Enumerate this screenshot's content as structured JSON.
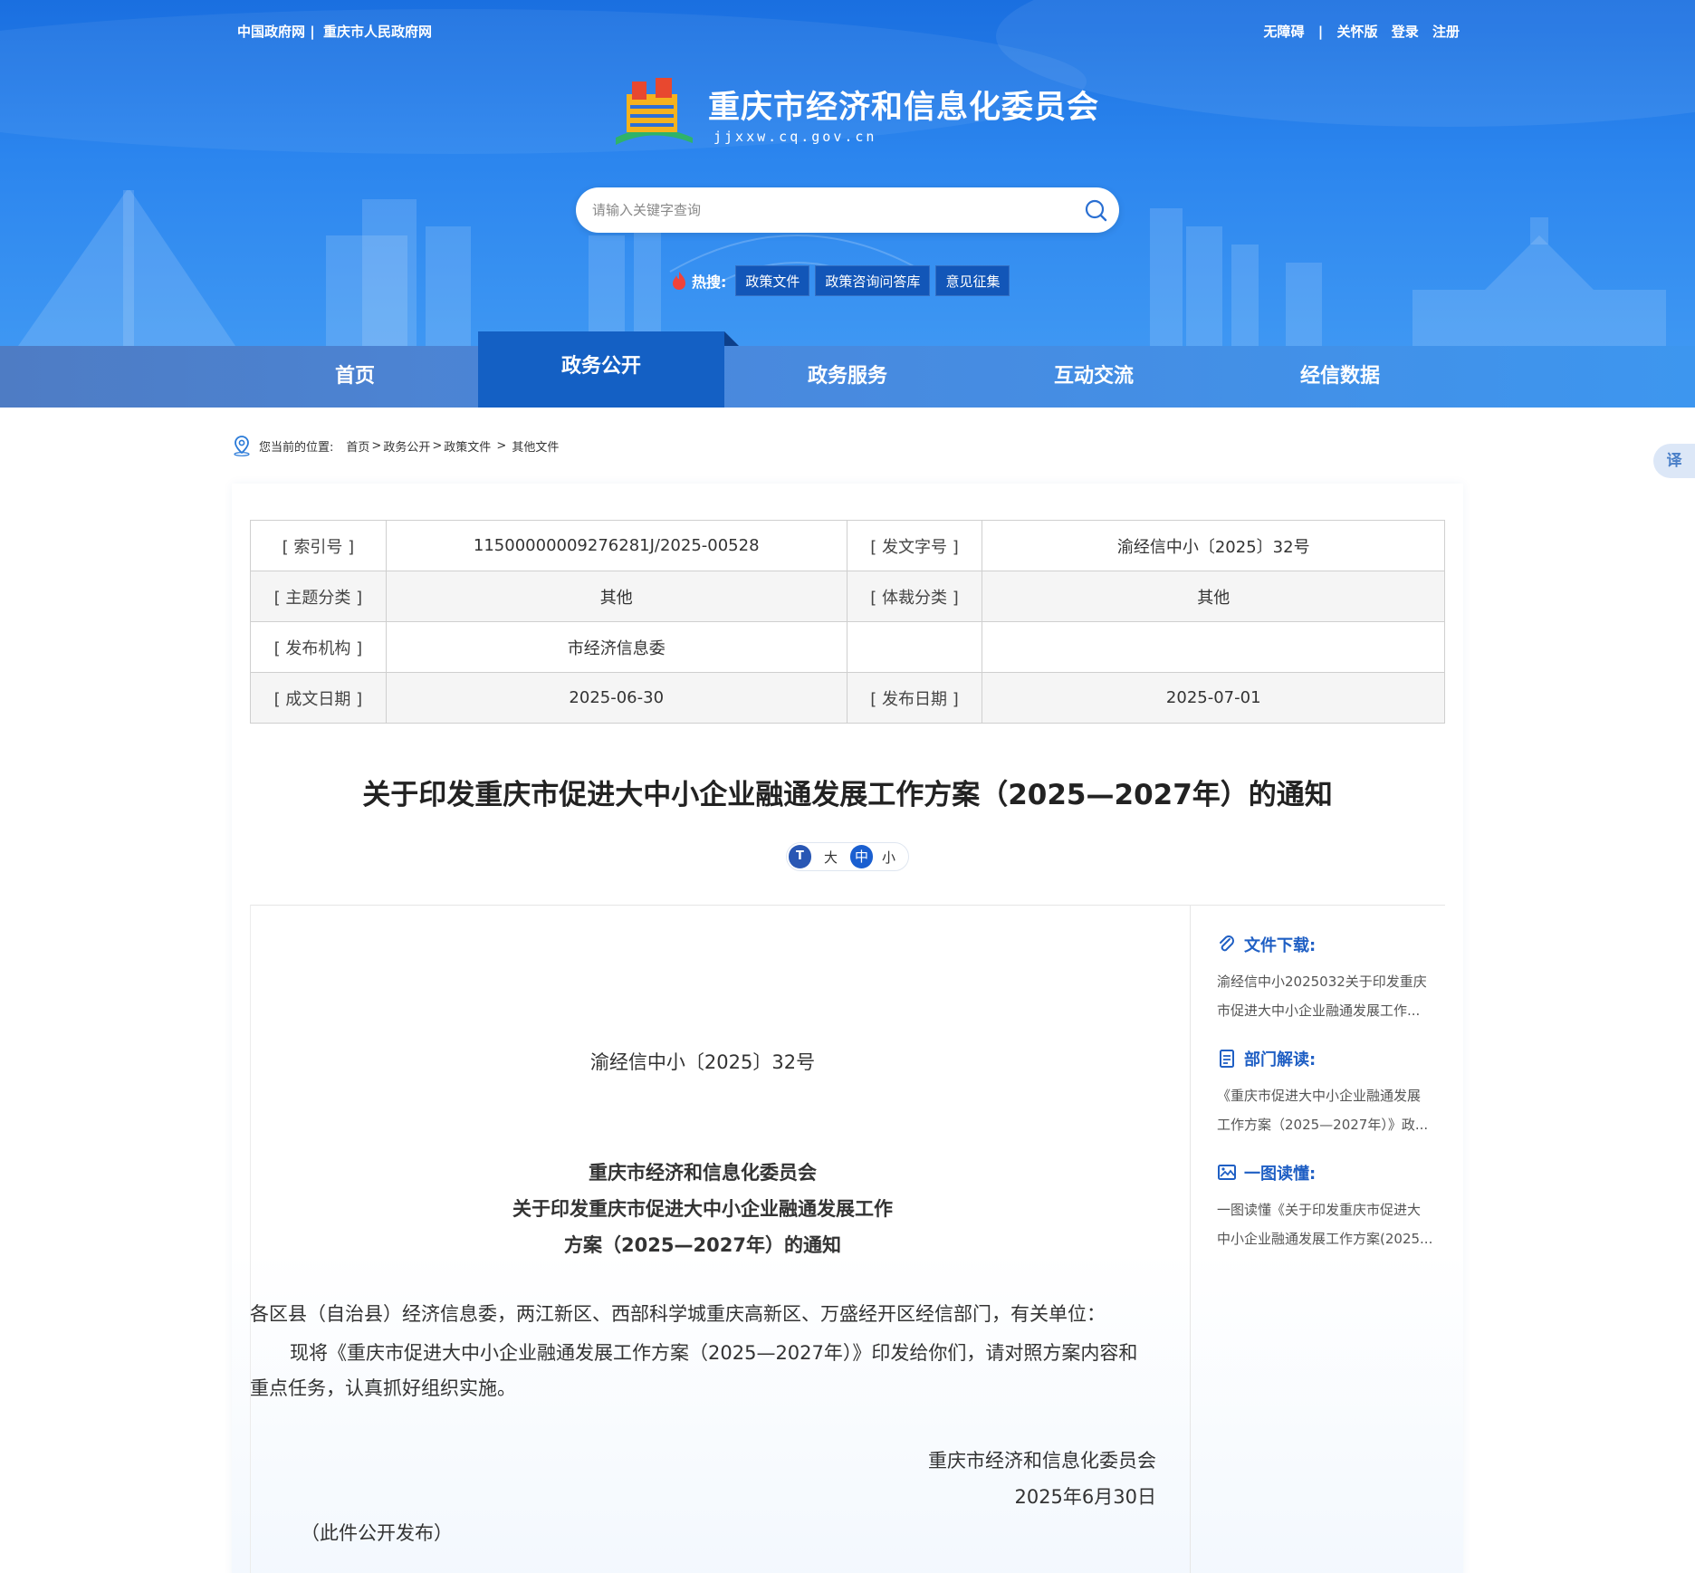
{
  "topbar": {
    "left": [
      "中国政府网 |",
      "重庆市人民政府网"
    ],
    "right": [
      "无障碍",
      "|",
      "关怀版",
      "登录",
      "注册"
    ]
  },
  "site": {
    "title": "重庆市经济和信息化委员会",
    "url": "jjxxw.cq.gov.cn"
  },
  "search": {
    "placeholder": "请输入关键字查询"
  },
  "hot": {
    "label": "热搜:",
    "tags": [
      "政策文件",
      "政策咨询问答库",
      "意见征集"
    ]
  },
  "nav": {
    "items": [
      "首页",
      "政务公开",
      "政务服务",
      "互动交流",
      "经信数据"
    ],
    "active": "政务公开"
  },
  "breadcrumb": {
    "lead": "您当前的位置:",
    "path": [
      "首页",
      ">",
      "政务公开",
      ">",
      "政策文件",
      " > ",
      "其他文件"
    ]
  },
  "translate": "译",
  "meta": {
    "index_label": "[ 索引号 ]",
    "index_value": "11500000009276281J/2025-00528",
    "docno_label": "[ 发文字号 ]",
    "docno_value": "渝经信中小〔2025〕32号",
    "topic_label": "[ 主题分类 ]",
    "topic_value": "其他",
    "genre_label": "[ 体裁分类 ]",
    "genre_value": "其他",
    "org_label": "[ 发布机构 ]",
    "org_value": "市经济信息委",
    "created_label": "[ 成文日期 ]",
    "created_value": "2025-06-30",
    "pub_label": "[ 发布日期 ]",
    "pub_value": "2025-07-01"
  },
  "doc": {
    "title": "关于印发重庆市促进大中小企业融通发展工作方案（2025—2027年）的通知",
    "font_icon": "T",
    "font_sizes": [
      "大",
      "中",
      "小"
    ],
    "font_active": "中",
    "number": "渝经信中小〔2025〕32号",
    "heading": [
      "重庆市经济和信息化委员会",
      "关于印发重庆市促进大中小企业融通发展工作",
      "方案（2025—2027年）的通知"
    ],
    "salutation": "各区县（自治县）经济信息委，两江新区、西部科学城重庆高新区、万盛经开区经信部门，有关单位：",
    "paragraph": "现将《重庆市促进大中小企业融通发展工作方案（2025—2027年）》印发给你们，请对照方案内容和重点任务，认真抓好组织实施。",
    "signature": "重庆市经济和信息化委员会",
    "date": "2025年6月30日",
    "publish_note": "（此件公开发布）"
  },
  "side": {
    "download": {
      "title": "文件下载:",
      "lines": [
        "渝经信中小2025032关于印发重庆",
        "市促进大中小企业融通发展工作..."
      ]
    },
    "interpret": {
      "title": "部门解读:",
      "lines": [
        "《重庆市促进大中小企业融通发展",
        "工作方案（2025—2027年）》政..."
      ]
    },
    "graphic": {
      "title": "一图读懂:",
      "lines": [
        "一图读懂《关于印发重庆市促进大",
        "中小企业融通发展工作方案(2025..."
      ]
    }
  },
  "colors": {
    "header_blue": "#1a6fe0",
    "nav_active": "#1460c4",
    "side_title": "#1f5fc4"
  }
}
